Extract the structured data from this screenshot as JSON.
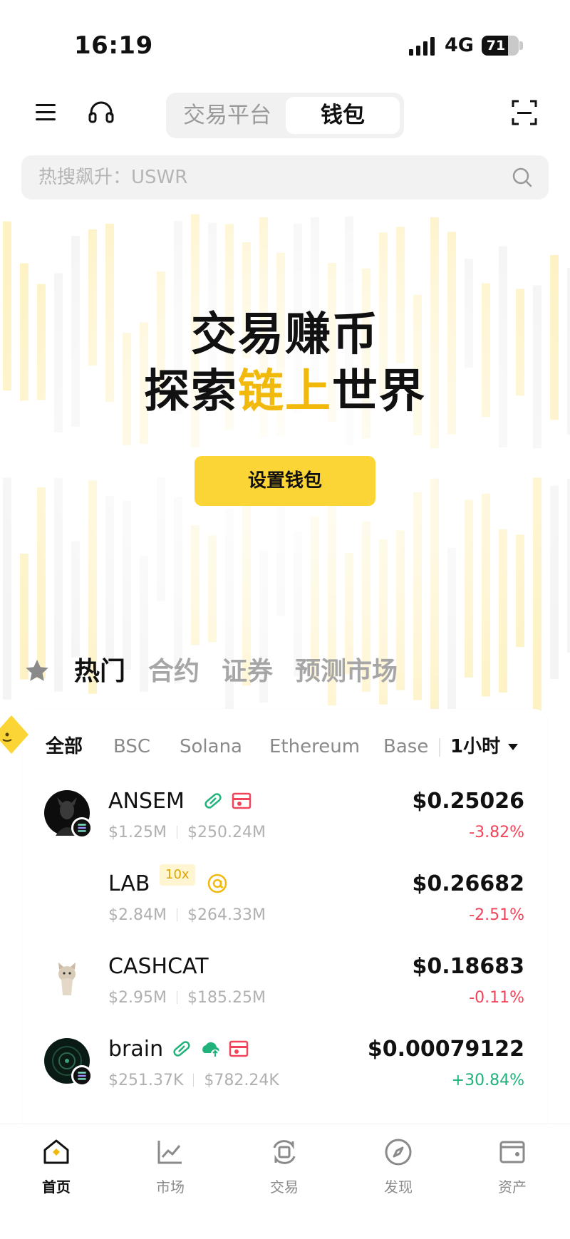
{
  "status_bar": {
    "time": "16:19",
    "network": "4G",
    "battery": "71",
    "battery_level": 0.71
  },
  "header": {
    "menu_icon": "menu-icon",
    "support_icon": "headset-icon",
    "tabs": [
      {
        "label": "交易平台",
        "active": false
      },
      {
        "label": "钱包",
        "active": true
      }
    ],
    "scan_icon": "scan-icon"
  },
  "search": {
    "placeholder": "热搜飙升：USWR",
    "icon": "search-icon"
  },
  "hero": {
    "line1": "交易赚币",
    "line2_pre": "探索",
    "line2_highlight": "链上",
    "line2_post": "世界",
    "cta_label": "设置钱包"
  },
  "categories": {
    "favorites_icon": "star-icon",
    "tabs": [
      {
        "label": "热门",
        "active": true
      },
      {
        "label": "合约"
      },
      {
        "label": "证券"
      },
      {
        "label": "预测市场"
      }
    ]
  },
  "chain_filter": {
    "chains": [
      {
        "label": "全部",
        "active": true
      },
      {
        "label": "BSC"
      },
      {
        "label": "Solana"
      },
      {
        "label": "Ethereum"
      },
      {
        "label": "Base"
      }
    ],
    "timeframe": "1小时"
  },
  "tokens": [
    {
      "name": "ANSEM",
      "volume": "$1.25M",
      "market_cap": "$250.24M",
      "price": "$0.25026",
      "change": "-3.82%",
      "direction": "down",
      "badges": [
        "pill-icon",
        "flame-icon"
      ]
    },
    {
      "name": "LAB",
      "leverage": "10x",
      "volume": "$2.84M",
      "market_cap": "$264.33M",
      "price": "$0.26682",
      "change": "-2.51%",
      "direction": "down",
      "badges": [
        "at-icon"
      ]
    },
    {
      "name": "CASHCAT",
      "volume": "$2.95M",
      "market_cap": "$185.25M",
      "price": "$0.18683",
      "change": "-0.11%",
      "direction": "down",
      "badges": []
    },
    {
      "name": "brain",
      "volume": "$251.37K",
      "market_cap": "$782.24K",
      "price": "$0.00079122",
      "change": "+30.84%",
      "direction": "up",
      "badges": [
        "pill-icon",
        "cloud-icon",
        "flame-icon"
      ]
    }
  ],
  "bottom_nav": [
    {
      "label": "首页",
      "icon": "home-icon",
      "active": true
    },
    {
      "label": "市场",
      "icon": "chart-icon"
    },
    {
      "label": "交易",
      "icon": "swap-icon"
    },
    {
      "label": "发现",
      "icon": "compass-icon"
    },
    {
      "label": "资产",
      "icon": "wallet-icon"
    }
  ],
  "colors": {
    "accent": "#fbd535",
    "highlight": "#f2b90d",
    "negative": "#f0445a",
    "positive": "#20b27a"
  }
}
